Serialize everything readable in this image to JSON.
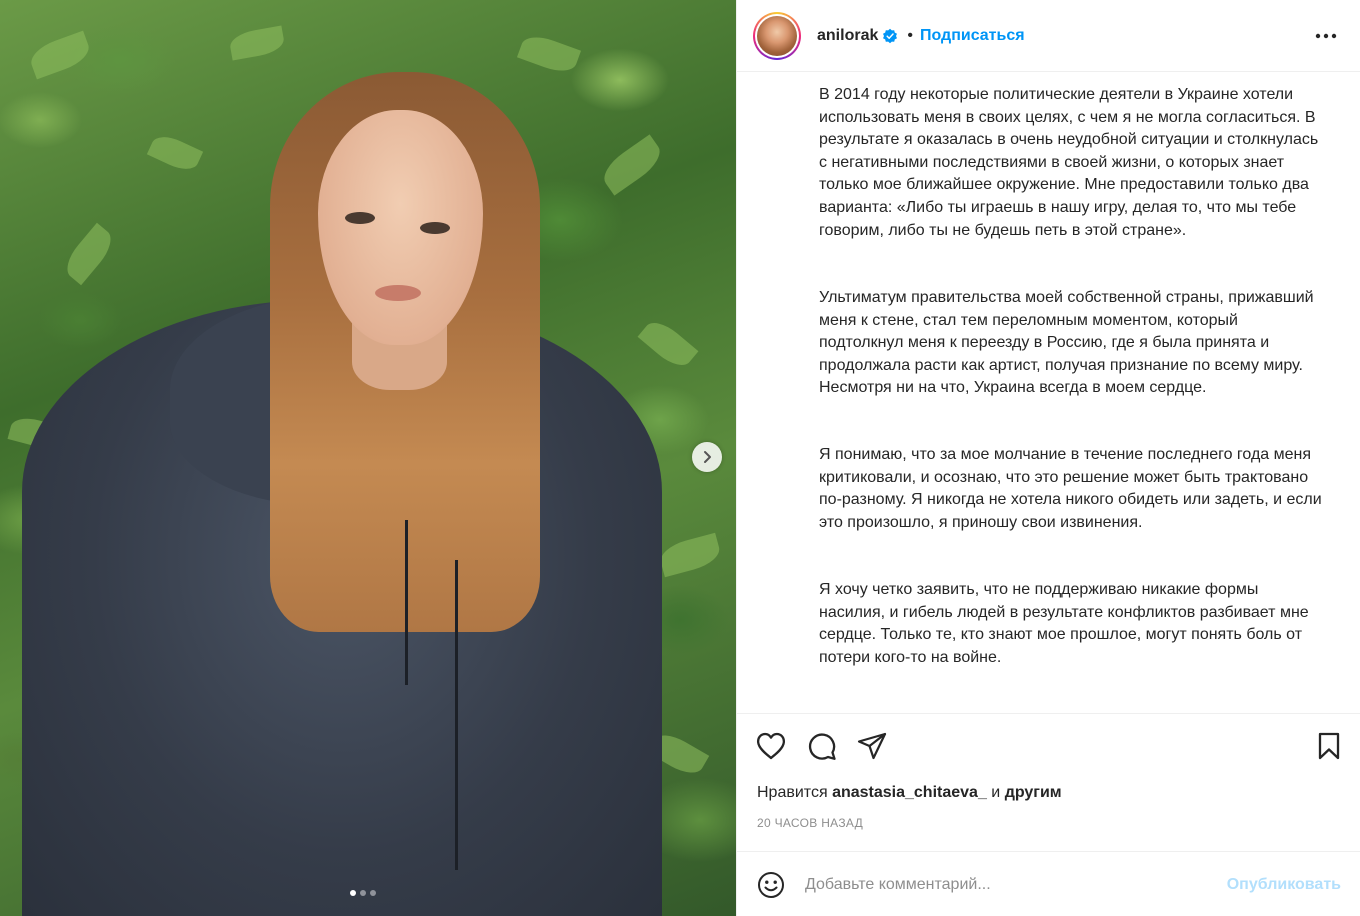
{
  "post": {
    "username": "anilorak",
    "follow_label": "Подписаться",
    "separator": "•",
    "caption_paragraphs": [
      "В 2014 году некоторые политические деятели в Украине хотели использовать меня в своих целях, с чем я не могла согласиться. В результате я оказалась в очень неудобной ситуации и столкнулась с негативными последствиями в своей жизни, о которых знает только мое ближайшее окружение. Мне предоставили только два варианта: «Либо ты играешь в нашу игру, делая то, что мы тебе говорим, либо ты не будешь петь в этой стране».",
      "Ультиматум правительства моей собственной страны, прижавший меня к стене, стал тем переломным моментом, который подтолкнул меня к переезду в Россию, где я была принята и продолжала расти как артист, получая признание по всему миру. Несмотря ни на что, Украина всегда в моем сердце.",
      "Я понимаю, что за мое молчание в течение последнего года меня критиковали, и осознаю, что это решение может быть трактовано по-разному. Я никогда не хотела никого обидеть или задеть, и если это произошло, я приношу свои извинения.",
      "Я хочу четко заявить, что не поддерживаю никакие формы насилия, и гибель людей в результате конфликтов разбивает мне сердце. Только те, кто знают мое прошлое, могут понять боль от потери кого-то на войне."
    ],
    "likes_prefix": "Нравится",
    "likes_user": "anastasia_chitaeva_",
    "likes_and": "и",
    "likes_others": "другим",
    "timestamp": "20 ЧАСОВ НАЗАД",
    "comment_placeholder": "Добавьте комментарий...",
    "publish_label": "Опубликовать",
    "carousel": {
      "total": 3,
      "current": 1
    }
  },
  "colors": {
    "accent": "#0095f6",
    "publish_disabled": "#b2dffc",
    "text": "#262626",
    "muted": "#8e8e8e"
  },
  "icons": {
    "verified": "verified-badge-icon",
    "more": "more-options-icon",
    "like": "heart-icon",
    "comment": "comment-bubble-icon",
    "share": "paper-plane-icon",
    "save": "bookmark-icon",
    "emoji": "emoji-smile-icon",
    "next": "chevron-right-icon"
  }
}
